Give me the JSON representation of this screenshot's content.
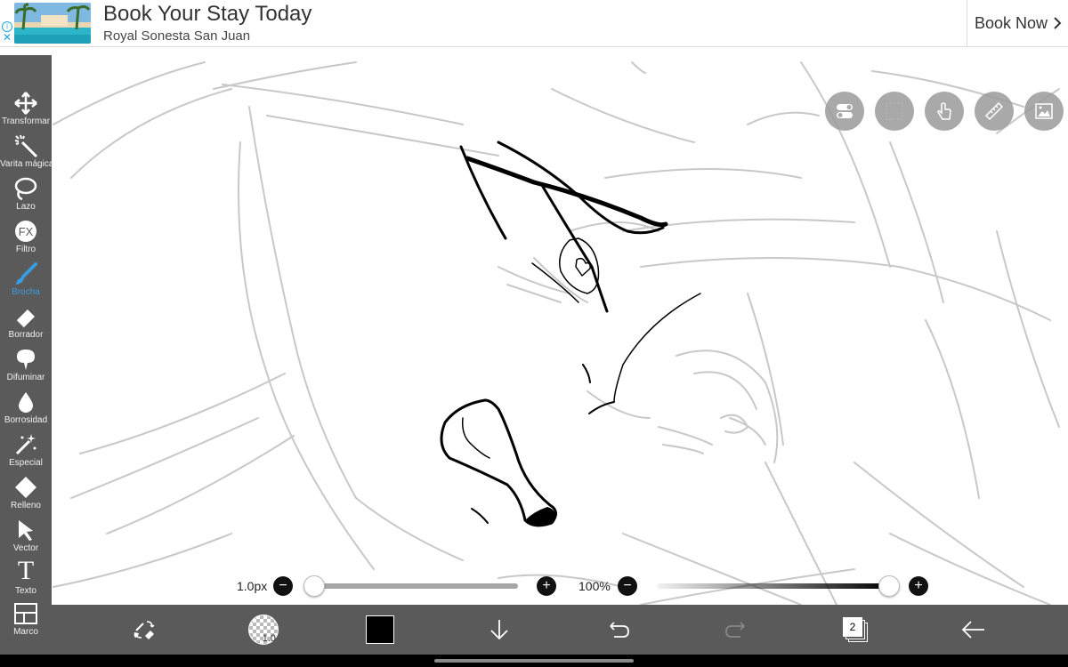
{
  "ad": {
    "title": "Book Your Stay Today",
    "subtitle": "Royal Sonesta San Juan",
    "cta": "Book Now",
    "info_icon": "info-icon",
    "close_icon": "close-icon"
  },
  "tools": [
    {
      "label": "Transformar",
      "icon": "move-icon"
    },
    {
      "label": "Varita mágica",
      "icon": "magic-wand-icon"
    },
    {
      "label": "Lazo",
      "icon": "lasso-icon"
    },
    {
      "label": "Filtro",
      "icon": "fx-icon"
    },
    {
      "label": "Brocha",
      "icon": "brush-icon",
      "active": true
    },
    {
      "label": "Borrador",
      "icon": "eraser-icon"
    },
    {
      "label": "Difuminar",
      "icon": "blur-icon"
    },
    {
      "label": "Borrosidad",
      "icon": "drop-icon"
    },
    {
      "label": "Especial",
      "icon": "special-icon"
    },
    {
      "label": "Relleno",
      "icon": "fill-icon"
    },
    {
      "label": "Vector",
      "icon": "vector-icon"
    },
    {
      "label": "Texto",
      "icon": "text-icon"
    },
    {
      "label": "Marco",
      "icon": "frame-icon"
    }
  ],
  "fx_glyph": "FX",
  "text_glyph": "T",
  "brush_size": {
    "label": "1.0px",
    "value": 0.0
  },
  "opacity": {
    "label": "100%",
    "value": 1.0
  },
  "bottom": {
    "brush_preview_size": "1.0",
    "layer_count": "2",
    "color": "#000000",
    "accent": "#3b9de0"
  }
}
